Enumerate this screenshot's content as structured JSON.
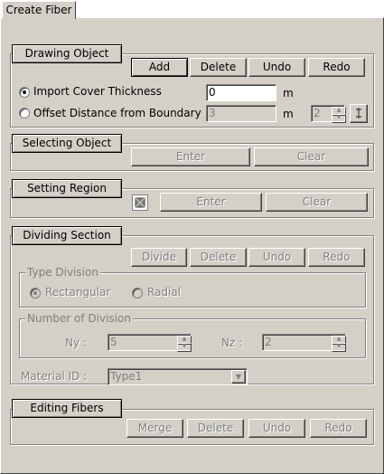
{
  "tab": {
    "label": "Create Fiber"
  },
  "drawing": {
    "header": "Drawing Object",
    "buttons": {
      "add": "Add",
      "delete": "Delete",
      "undo": "Undo",
      "redo": "Redo"
    },
    "import_label": "Import Cover Thickness",
    "import_value": "0",
    "import_unit": "m",
    "offset_label": "Offset Distance from Boundary",
    "offset_value": "3",
    "offset_unit": "m",
    "offset_count": "2"
  },
  "selecting": {
    "header": "Selecting Object",
    "enter": "Enter",
    "clear": "Clear"
  },
  "region": {
    "header": "Setting Region",
    "enter": "Enter",
    "clear": "Clear"
  },
  "dividing": {
    "header": "Dividing Section",
    "buttons": {
      "divide": "Divide",
      "delete": "Delete",
      "undo": "Undo",
      "redo": "Redo"
    },
    "type_legend": "Type Division",
    "rectangular": "Rectangular",
    "radial": "Radial",
    "number_legend": "Number of Division",
    "ny_label": "Ny :",
    "ny_value": "5",
    "nz_label": "Nz :",
    "nz_value": "2",
    "material_label": "Material ID :",
    "material_value": "Type1"
  },
  "editing": {
    "header": "Editing Fibers",
    "buttons": {
      "merge": "Merge",
      "delete": "Delete",
      "undo": "Undo",
      "redo": "Redo"
    }
  }
}
